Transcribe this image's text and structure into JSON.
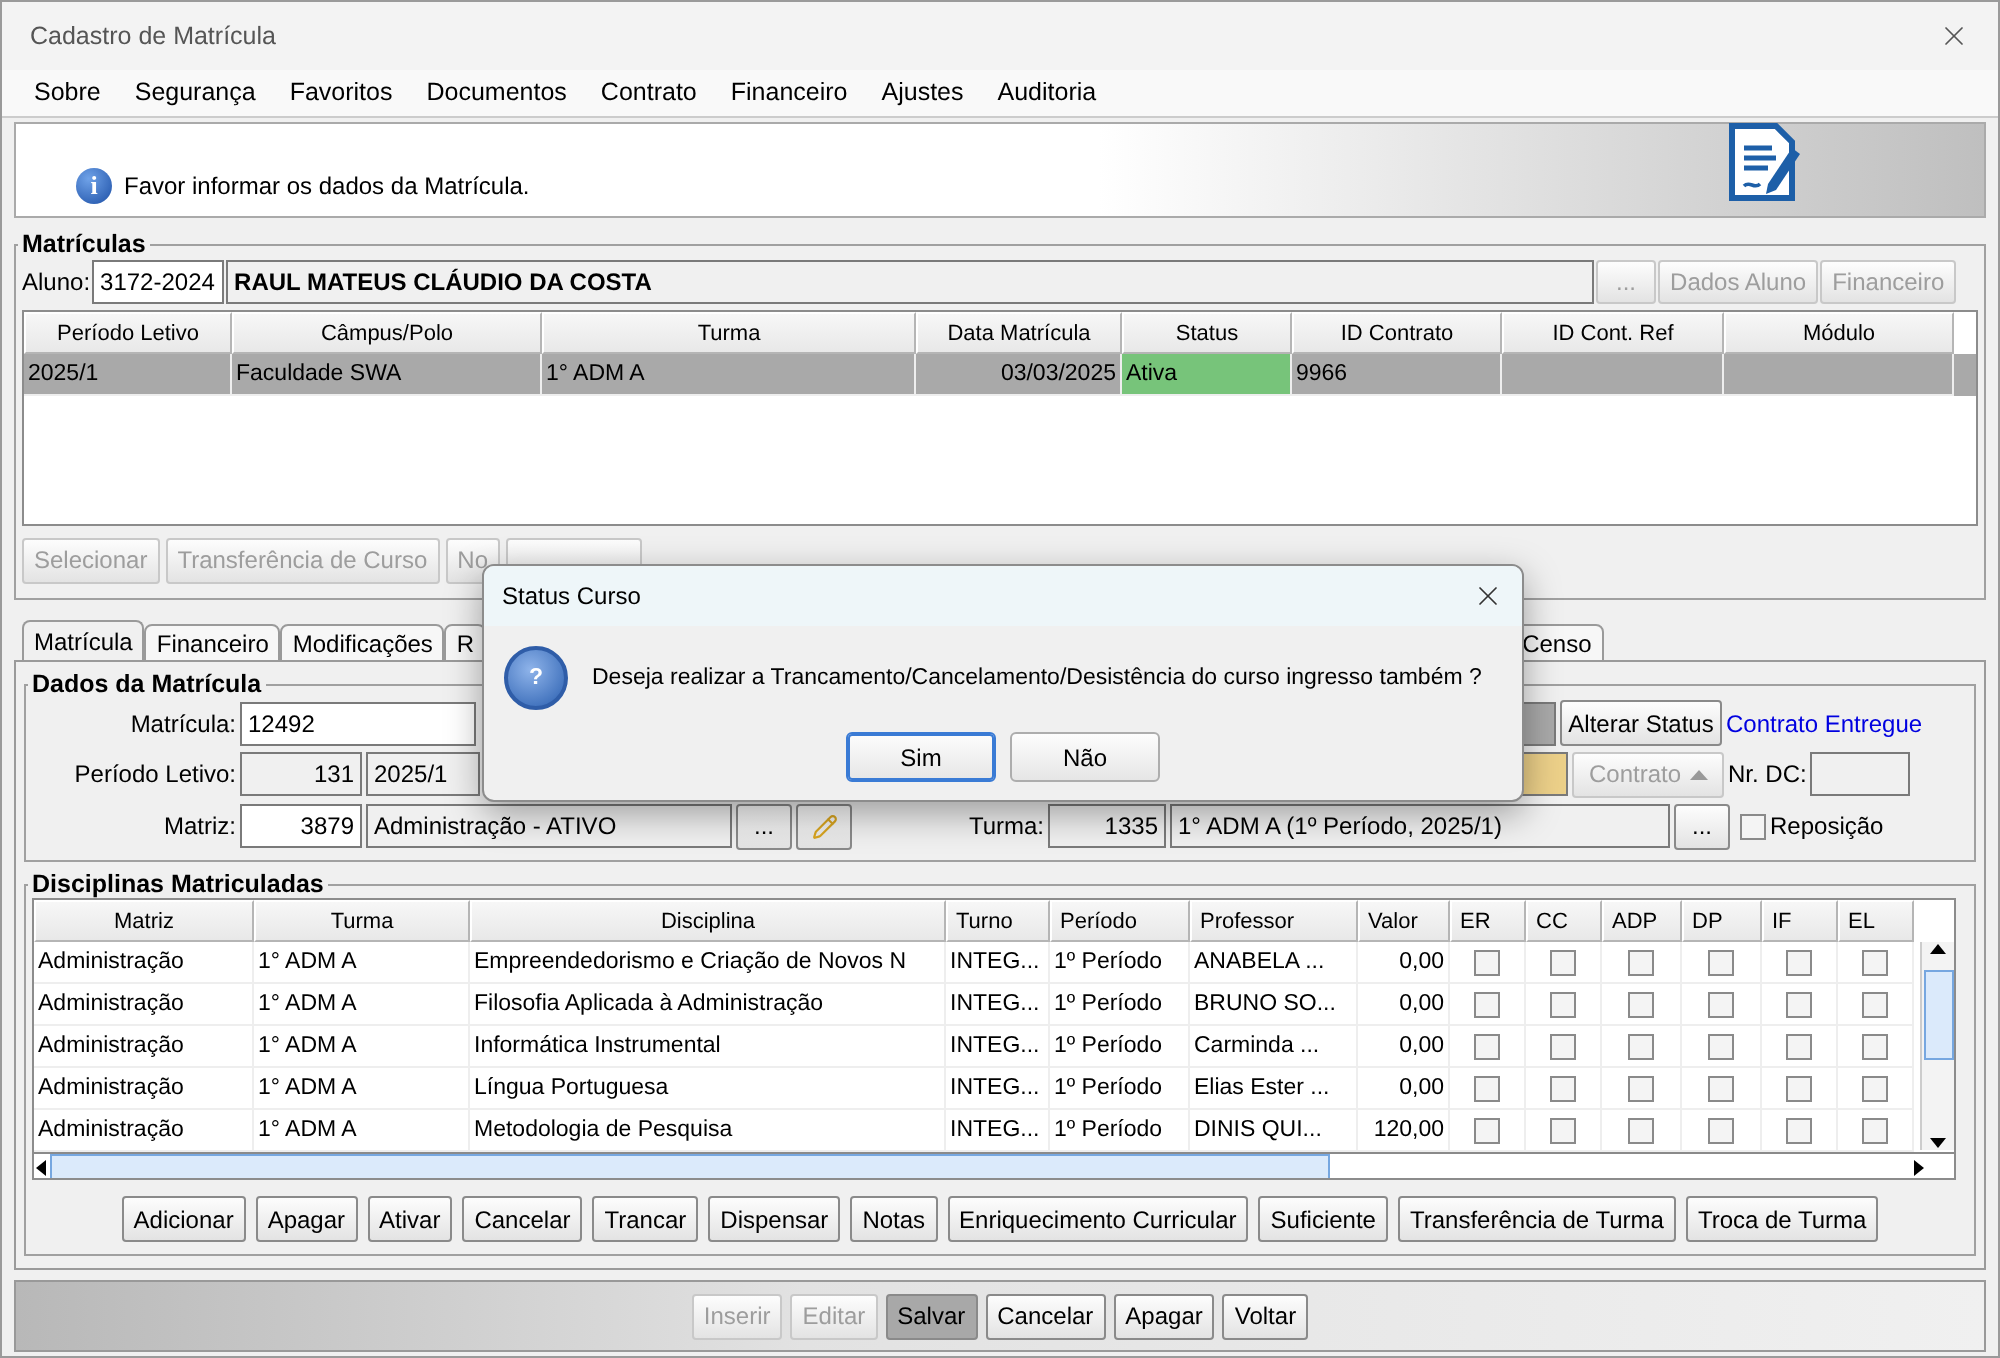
{
  "window": {
    "title": "Cadastro de Matrícula"
  },
  "menu": [
    {
      "label": "Sobre"
    },
    {
      "label": "Segurança"
    },
    {
      "label": "Favoritos"
    },
    {
      "label": "Documentos"
    },
    {
      "label": "Contrato"
    },
    {
      "label": "Financeiro"
    },
    {
      "label": "Ajustes"
    },
    {
      "label": "Auditoria"
    }
  ],
  "info": {
    "icon": "i",
    "message": "Favor informar os dados da Matrícula."
  },
  "matriculas": {
    "title": "Matrículas",
    "aluno_label": "Aluno:",
    "aluno_code": "3172-2024",
    "aluno_name": "RAUL MATEUS CLÁUDIO DA COSTA",
    "browse": "...",
    "buttons": [
      {
        "label": "Dados Aluno",
        "disabled": true
      },
      {
        "label": "Financeiro",
        "disabled": true
      }
    ],
    "columns": [
      "Período Letivo",
      "Câmpus/Polo",
      "Turma",
      "Data Matrícula",
      "Status",
      "ID Contrato",
      "ID Cont. Ref",
      "Módulo"
    ],
    "rows": [
      {
        "selected": true,
        "cells": [
          "2025/1",
          "Faculdade SWA",
          "1° ADM A",
          "03/03/2025",
          "Ativa",
          "9966",
          "",
          ""
        ],
        "color": "#77c47a"
      }
    ],
    "actions": [
      {
        "label": "Selecionar",
        "disabled": true
      },
      {
        "label": "Transferência de Curso",
        "disabled": true
      },
      {
        "label": "No",
        "disabled": true
      },
      {
        "disabled": true
      }
    ]
  },
  "tabs": [
    {
      "label": "Matrícula",
      "selected": true
    },
    {
      "label": "Financeiro",
      "selected": false
    },
    {
      "label": "Modificações",
      "selected": false
    },
    {
      "label": "R",
      "selected": false
    },
    {
      "label": "Censo",
      "selected": false
    }
  ],
  "dados": {
    "title": "Dados da Matrícula",
    "matricula_label": "Matrícula:",
    "matricula": "12492",
    "alterar_status": "Alterar Status",
    "contrato_entregue": "Contrato Entregue",
    "periodo_label": "Período Letivo:",
    "periodo_code": "131",
    "periodo": "2025/1",
    "contrato_button": {
      "label": "Contrato",
      "disabled": true
    },
    "nr_dc_label": "Nr. DC:",
    "matriz_label": "Matriz:",
    "matriz_code": "3879",
    "matriz": "Administração - ATIVO",
    "matriz_browse": "...",
    "turma_label": "Turma:",
    "turma_code": "1335",
    "turma": "1° ADM A (1º Período, 2025/1)",
    "turma_browse": "...",
    "reposicao": {
      "label": "Reposição",
      "checked": false
    }
  },
  "disciplinas": {
    "title": "Disciplinas Matriculadas",
    "columns": [
      "Matriz",
      "Turma",
      "Disciplina",
      "Turno",
      "Período",
      "Professor",
      "Valor",
      "ER",
      "CC",
      "ADP",
      "DP",
      "IF",
      "EL"
    ],
    "rows": [
      {
        "cells": [
          "Administração",
          "1° ADM A",
          "Empreendedorismo e Criação de Novos N",
          "INTEG...",
          "1º Período",
          "ANABELA ...",
          "0,00"
        ],
        "checks": [
          false,
          false,
          false,
          false,
          false,
          false
        ]
      },
      {
        "cells": [
          "Administração",
          "1° ADM A",
          "Filosofia Aplicada à Administração",
          "INTEG...",
          "1º Período",
          "BRUNO SO...",
          "0,00"
        ],
        "checks": [
          false,
          false,
          false,
          false,
          false,
          false
        ]
      },
      {
        "cells": [
          "Administração",
          "1° ADM A",
          "Informática Instrumental",
          "INTEG...",
          "1º Período",
          "Carminda ...",
          "0,00"
        ],
        "checks": [
          false,
          false,
          false,
          false,
          false,
          false
        ]
      },
      {
        "cells": [
          "Administração",
          "1° ADM A",
          "Língua Portuguesa",
          "INTEG...",
          "1º Período",
          "Elias Ester ...",
          "0,00"
        ],
        "checks": [
          false,
          false,
          false,
          false,
          false,
          false
        ]
      },
      {
        "cells": [
          "Administração",
          "1° ADM A",
          "Metodologia de Pesquisa",
          "INTEG...",
          "1º Período",
          "DINIS QUI...",
          "120,00"
        ],
        "checks": [
          false,
          false,
          false,
          false,
          false,
          false
        ]
      }
    ],
    "buttons": [
      "Adicionar",
      "Apagar",
      "Ativar",
      "Cancelar",
      "Trancar",
      "Dispensar",
      "Notas",
      "Enriquecimento Curricular",
      "Suficiente",
      "Transferência de Turma",
      "Troca de Turma"
    ]
  },
  "footer": [
    {
      "label": "Inserir",
      "disabled": true,
      "selected": false
    },
    {
      "label": "Editar",
      "disabled": true,
      "selected": false
    },
    {
      "label": "Salvar",
      "disabled": false,
      "selected": true
    },
    {
      "label": "Cancelar",
      "disabled": false,
      "selected": false
    },
    {
      "label": "Apagar",
      "disabled": false,
      "selected": false
    },
    {
      "label": "Voltar",
      "disabled": false,
      "selected": false
    }
  ],
  "dialog": {
    "title": "Status Curso",
    "icon": "?",
    "message": "Deseja realizar a Trancamento/Cancelamento/Desistência do curso ingresso também ?",
    "buttons": [
      {
        "label": "Sim",
        "selected": true
      },
      {
        "label": "Não",
        "selected": false
      }
    ]
  }
}
